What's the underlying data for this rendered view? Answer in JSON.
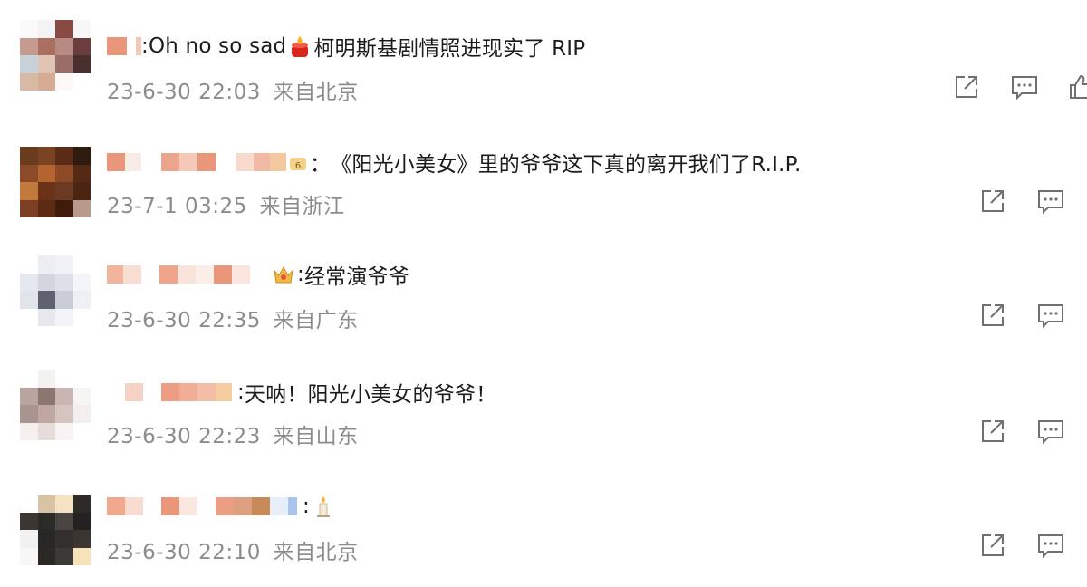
{
  "comments": [
    {
      "separator": ":",
      "text": "Oh no so sad",
      "emoji": "candle-emoji",
      "text_after": "柯明斯基剧情照进现实了 RIP",
      "date": "23-6-30 22:03",
      "location": "来自北京",
      "actions": [
        "share-icon",
        "comment-icon",
        "like-icon"
      ]
    },
    {
      "separator": "：",
      "text": "《阳光小美女》里的爷爷这下真的离开我们了R.I.P.",
      "date": "23-7-1 03:25",
      "location": "来自浙江",
      "badge": "member-badge-icon",
      "actions": [
        "share-icon",
        "comment-icon"
      ]
    },
    {
      "separator": ":",
      "text": "经常演爷爷",
      "badge": "crown-badge-icon",
      "date": "23-6-30 22:35",
      "location": "来自广东",
      "actions": [
        "share-icon",
        "comment-icon"
      ]
    },
    {
      "separator": ":",
      "text": "天呐！阳光小美女的爷爷！",
      "date": "23-6-30 22:23",
      "location": "来自山东",
      "actions": [
        "share-icon",
        "comment-icon"
      ]
    },
    {
      "separator": ":",
      "emoji": "candle-emoji",
      "date": "23-6-30 22:10",
      "location": "来自北京",
      "actions": [
        "share-icon",
        "comment-icon"
      ]
    }
  ],
  "colors": {
    "meta_text": "#8c8c8c",
    "body_text": "#1c1c1c",
    "icon_stroke": "#707070",
    "blurred_name": "#e9967a"
  }
}
